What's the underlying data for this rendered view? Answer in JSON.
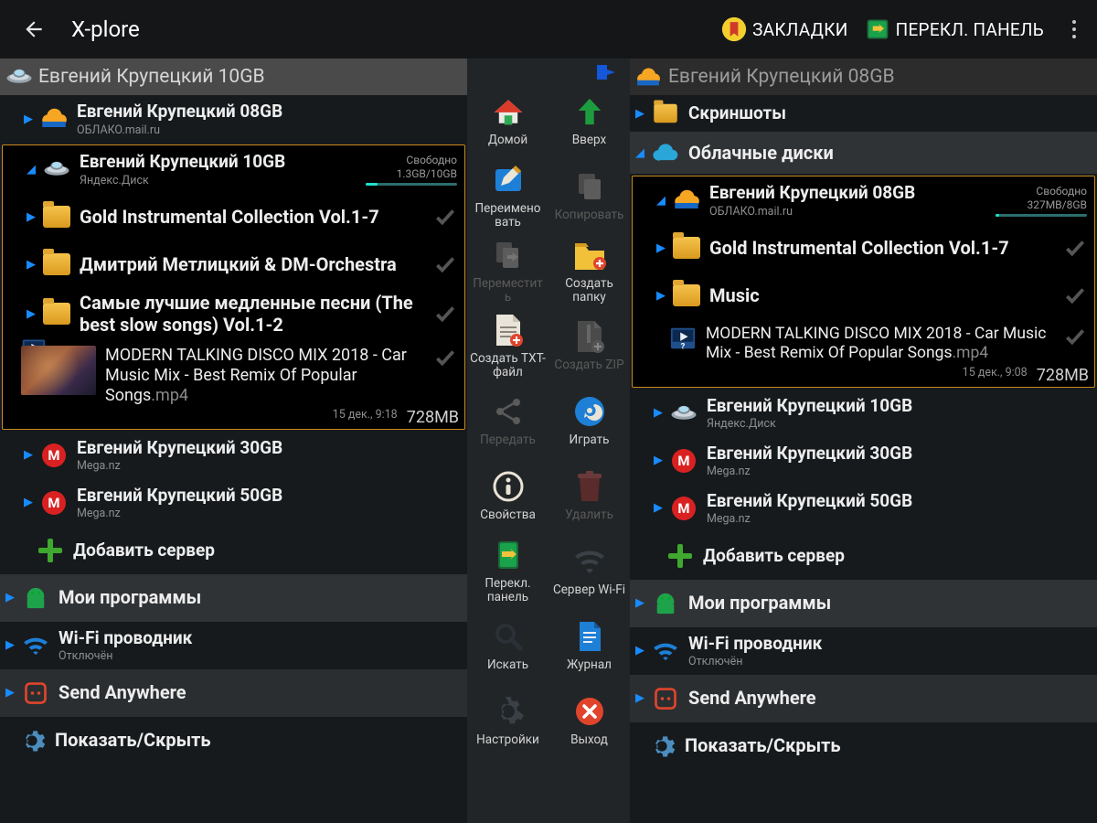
{
  "topbar": {
    "title": "X-plore",
    "bookmarks": "ЗАКЛАДКИ",
    "switch": "ПЕРЕКЛ. ПАНЕЛЬ"
  },
  "left": {
    "header": "Евгений Крупецкий 10GB",
    "acct08": {
      "title": "Евгений Крупецкий 08GB",
      "sub": "ОБЛАКО.mail.ru"
    },
    "acct10": {
      "title": "Евгений Крупецкий 10GB",
      "sub": "Яндекс.Диск",
      "free_label": "Свободно",
      "free_value": "1.3GB/10GB",
      "free_pct": 13
    },
    "folders": [
      "Gold Instrumental Collection Vol.1-7",
      "Дмитрий Метлицкий & DM-Orchestra",
      "Самые лучшие медленные песни (The best slow songs) Vol.1-2"
    ],
    "file": {
      "name": "MODERN TALKING DISCO MIX 2018 - Car Music Mix - Best Remix Of Popular Songs",
      "ext": ".mp4",
      "date": "15 дек., 9:18",
      "size": "728MB"
    },
    "acct30": {
      "title": "Евгений Крупецкий 30GB",
      "sub": "Mega.nz"
    },
    "acct50": {
      "title": "Евгений Крупецкий 50GB",
      "sub": "Mega.nz"
    },
    "add_server": "Добавить сервер",
    "my_apps": "Мои программы",
    "wifi": {
      "title": "Wi-Fi проводник",
      "sub": "Отключён"
    },
    "send": "Send Anywhere",
    "show_hide": "Показать/Скрыть"
  },
  "tools": {
    "home": "Домой",
    "up": "Вверх",
    "rename": "Переимено вать",
    "copy": "Копировать",
    "move": "Переместит ь",
    "newfolder": "Создать папку",
    "newtxt": "Создать TXT-файл",
    "newzip": "Создать ZIP",
    "share": "Передать",
    "play": "Играть",
    "props": "Свойства",
    "delete": "Удалить",
    "switch": "Перекл. панель",
    "wifi": "Сервер Wi-Fi",
    "search": "Искать",
    "log": "Журнал",
    "settings": "Настройки",
    "exit": "Выход"
  },
  "right": {
    "header": "Евгений Крупецкий 08GB",
    "screenshots": "Скриншоты",
    "clouds": "Облачные диски",
    "acct08": {
      "title": "Евгений Крупецкий 08GB",
      "sub": "ОБЛАКО.mail.ru",
      "free_label": "Свободно",
      "free_value": "327MB/8GB",
      "free_pct": 4
    },
    "folders": [
      "Gold Instrumental Collection Vol.1-7",
      "Music"
    ],
    "file": {
      "name": "MODERN TALKING DISCO MIX 2018 - Car Music Mix - Best Remix Of Popular Songs",
      "ext": ".mp4",
      "date": "15 дек., 9:08",
      "size": "728MB"
    },
    "acct10": {
      "title": "Евгений Крупецкий 10GB",
      "sub": "Яндекс.Диск"
    },
    "acct30": {
      "title": "Евгений Крупецкий 30GB",
      "sub": "Mega.nz"
    },
    "acct50": {
      "title": "Евгений Крупецкий 50GB",
      "sub": "Mega.nz"
    },
    "add_server": "Добавить сервер",
    "my_apps": "Мои программы",
    "wifi": {
      "title": "Wi-Fi проводник",
      "sub": "Отключён"
    },
    "send": "Send Anywhere",
    "show_hide": "Показать/Скрыть"
  }
}
